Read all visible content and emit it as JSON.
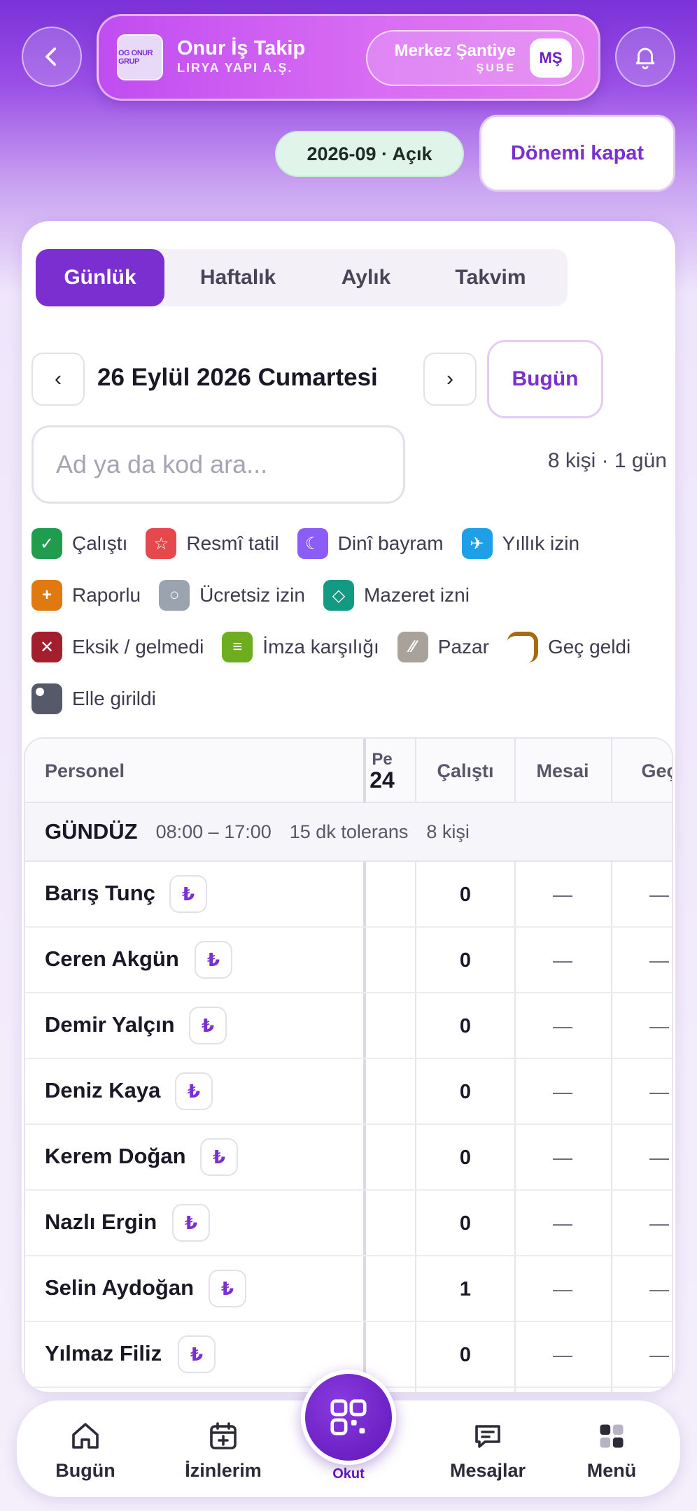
{
  "header": {
    "brand_name": "Onur İş Takip",
    "brand_company": "LIRYA YAPI A.Ş.",
    "logo_text": "OG ONUR GRUP",
    "branch_name": "Merkez Şantiye",
    "branch_type": "ŞUBE",
    "branch_initials": "MŞ",
    "period_badge": "2026-09 · Açık",
    "close_period_label": "Dönemi kapat"
  },
  "tabs": [
    {
      "label": "Günlük",
      "active": true
    },
    {
      "label": "Haftalık",
      "active": false
    },
    {
      "label": "Aylık",
      "active": false
    },
    {
      "label": "Takvim",
      "active": false
    }
  ],
  "date_nav": {
    "prev": "‹",
    "next": "›",
    "date_label": "26 Eylül 2026 Cumartesi",
    "today_label": "Bugün"
  },
  "search": {
    "placeholder": "Ad ya da kod ara...",
    "count_text": "8 kişi · 1 gün"
  },
  "legend": [
    {
      "label": "Çalıştı",
      "color": "#1f9d4c",
      "symbol": "✓"
    },
    {
      "label": "Resmî tatil",
      "color": "#e5484d",
      "symbol": "☆"
    },
    {
      "label": "Dinî bayram",
      "color": "#8b5cf6",
      "symbol": "☾"
    },
    {
      "label": "Yıllık izin",
      "color": "#1e9fe8",
      "symbol": "✈"
    },
    {
      "label": "Raporlu",
      "color": "#e07a10",
      "symbol": "+"
    },
    {
      "label": "Ücretsiz izin",
      "color": "#9aa3ae",
      "symbol": "○"
    },
    {
      "label": "Mazeret izni",
      "color": "#129a83",
      "symbol": "◇"
    },
    {
      "label": "Eksik / gelmedi",
      "color": "#a31f2e",
      "symbol": "✕"
    },
    {
      "label": "İmza karşılığı",
      "color": "#6cae1f",
      "symbol": "≡"
    },
    {
      "label": "Pazar",
      "color": "#a8a29a",
      "symbol": "⁄⁄"
    },
    {
      "label": "Geç geldi",
      "color": "#a86a10",
      "symbol": ""
    },
    {
      "label": "Elle girildi",
      "color": "#55596a",
      "symbol": "●"
    }
  ],
  "table": {
    "headers": {
      "personel": "Personel",
      "day_dow": "Pe",
      "day_num": "24",
      "calisti": "Çalıştı",
      "mesai": "Mesai",
      "gec": "Geç"
    },
    "shift": {
      "name": "GÜNDÜZ",
      "hours": "08:00 – 17:00",
      "tolerance": "15 dk tolerans",
      "count": "8 kişi"
    },
    "currency_symbol": "₺",
    "rows": [
      {
        "name": "Barış Tunç",
        "calisti": "0",
        "mesai": "—",
        "gec": "—"
      },
      {
        "name": "Ceren Akgün",
        "calisti": "0",
        "mesai": "—",
        "gec": "—"
      },
      {
        "name": "Demir Yalçın",
        "calisti": "0",
        "mesai": "—",
        "gec": "—"
      },
      {
        "name": "Deniz Kaya",
        "calisti": "0",
        "mesai": "—",
        "gec": "—"
      },
      {
        "name": "Kerem Doğan",
        "calisti": "0",
        "mesai": "—",
        "gec": "—"
      },
      {
        "name": "Nazlı Ergin",
        "calisti": "0",
        "mesai": "—",
        "gec": "—"
      },
      {
        "name": "Selin Aydoğan",
        "calisti": "1",
        "mesai": "—",
        "gec": "—"
      },
      {
        "name": "Yılmaz Filiz",
        "calisti": "0",
        "mesai": "—",
        "gec": "—"
      }
    ]
  },
  "bottom_nav": {
    "items": [
      {
        "label": "Bugün",
        "icon": "home-icon"
      },
      {
        "label": "İzinlerim",
        "icon": "calendar-plus-icon"
      },
      {
        "label": "Mesajlar",
        "icon": "message-icon"
      },
      {
        "label": "Menü",
        "icon": "grid-menu-icon"
      }
    ],
    "scan_label": "Okut"
  }
}
